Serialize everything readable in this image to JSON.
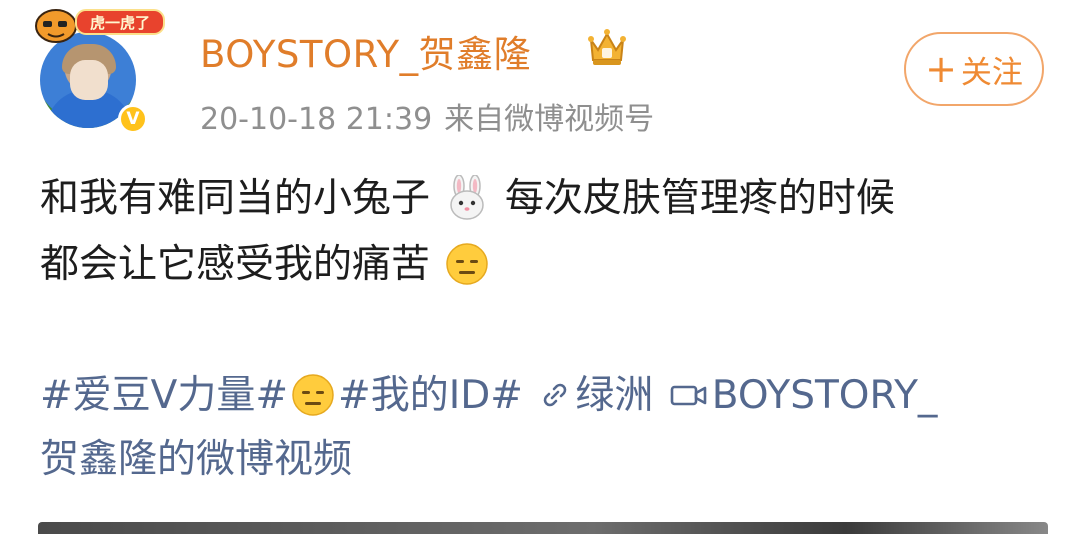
{
  "header": {
    "username": "BOYSTORY_贺鑫隆",
    "timestamp": "20-10-18 21:39",
    "source": "来自微博视频号",
    "follow_label": "关注",
    "avatar_banner_text": "虎一虎了"
  },
  "post": {
    "line1_a": "和我有难同当的小兔子",
    "line1_b": "每次皮肤管理疼的时候",
    "line2": "都会让它感受我的痛苦",
    "tag1": "#爱豆V力量#",
    "tag2": "#我的ID#",
    "link_label": "绿洲",
    "video_label_a": "BOYSTORY_",
    "video_label_b": "贺鑫隆的微博视频"
  },
  "icons": {
    "rabbit": "rabbit-face-emoji",
    "expressionless": "expressionless-face-emoji",
    "link": "link-icon",
    "video": "video-camera-icon",
    "crown": "crown-badge-icon",
    "verified": "verified-v-icon"
  },
  "colors": {
    "username": "#e07d2a",
    "link_blue": "#54688e",
    "follow_border": "#f2a66a",
    "meta_gray": "#8f8f8f",
    "verified_yellow": "#ffc21b"
  }
}
